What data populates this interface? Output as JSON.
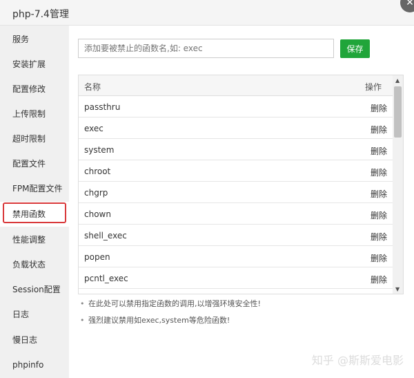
{
  "window": {
    "title": "php-7.4管理"
  },
  "sidebar": {
    "items": [
      {
        "label": "服务"
      },
      {
        "label": "安装扩展"
      },
      {
        "label": "配置修改"
      },
      {
        "label": "上传限制"
      },
      {
        "label": "超时限制"
      },
      {
        "label": "配置文件"
      },
      {
        "label": "FPM配置文件"
      },
      {
        "label": "禁用函数",
        "active": true
      },
      {
        "label": "性能调整"
      },
      {
        "label": "负载状态"
      },
      {
        "label": "Session配置"
      },
      {
        "label": "日志"
      },
      {
        "label": "慢日志"
      },
      {
        "label": "phpinfo"
      }
    ]
  },
  "form": {
    "input_value": "",
    "placeholder": "添加要被禁止的函数名,如: exec",
    "save_label": "保存"
  },
  "table": {
    "headers": {
      "name": "名称",
      "action": "操作"
    },
    "rows": [
      {
        "name": "passthru",
        "action": "删除"
      },
      {
        "name": "exec",
        "action": "删除"
      },
      {
        "name": "system",
        "action": "删除"
      },
      {
        "name": "chroot",
        "action": "删除"
      },
      {
        "name": "chgrp",
        "action": "删除"
      },
      {
        "name": "chown",
        "action": "删除"
      },
      {
        "name": "shell_exec",
        "action": "删除"
      },
      {
        "name": "popen",
        "action": "删除"
      },
      {
        "name": "pcntl_exec",
        "action": "删除"
      }
    ]
  },
  "notes": [
    "在此处可以禁用指定函数的调用,以增强环境安全性!",
    "强烈建议禁用如exec,system等危险函数!"
  ],
  "watermark": "知乎 @斯斯爱电影",
  "colors": {
    "accent": "#20a53a",
    "highlight": "#d9383a"
  }
}
